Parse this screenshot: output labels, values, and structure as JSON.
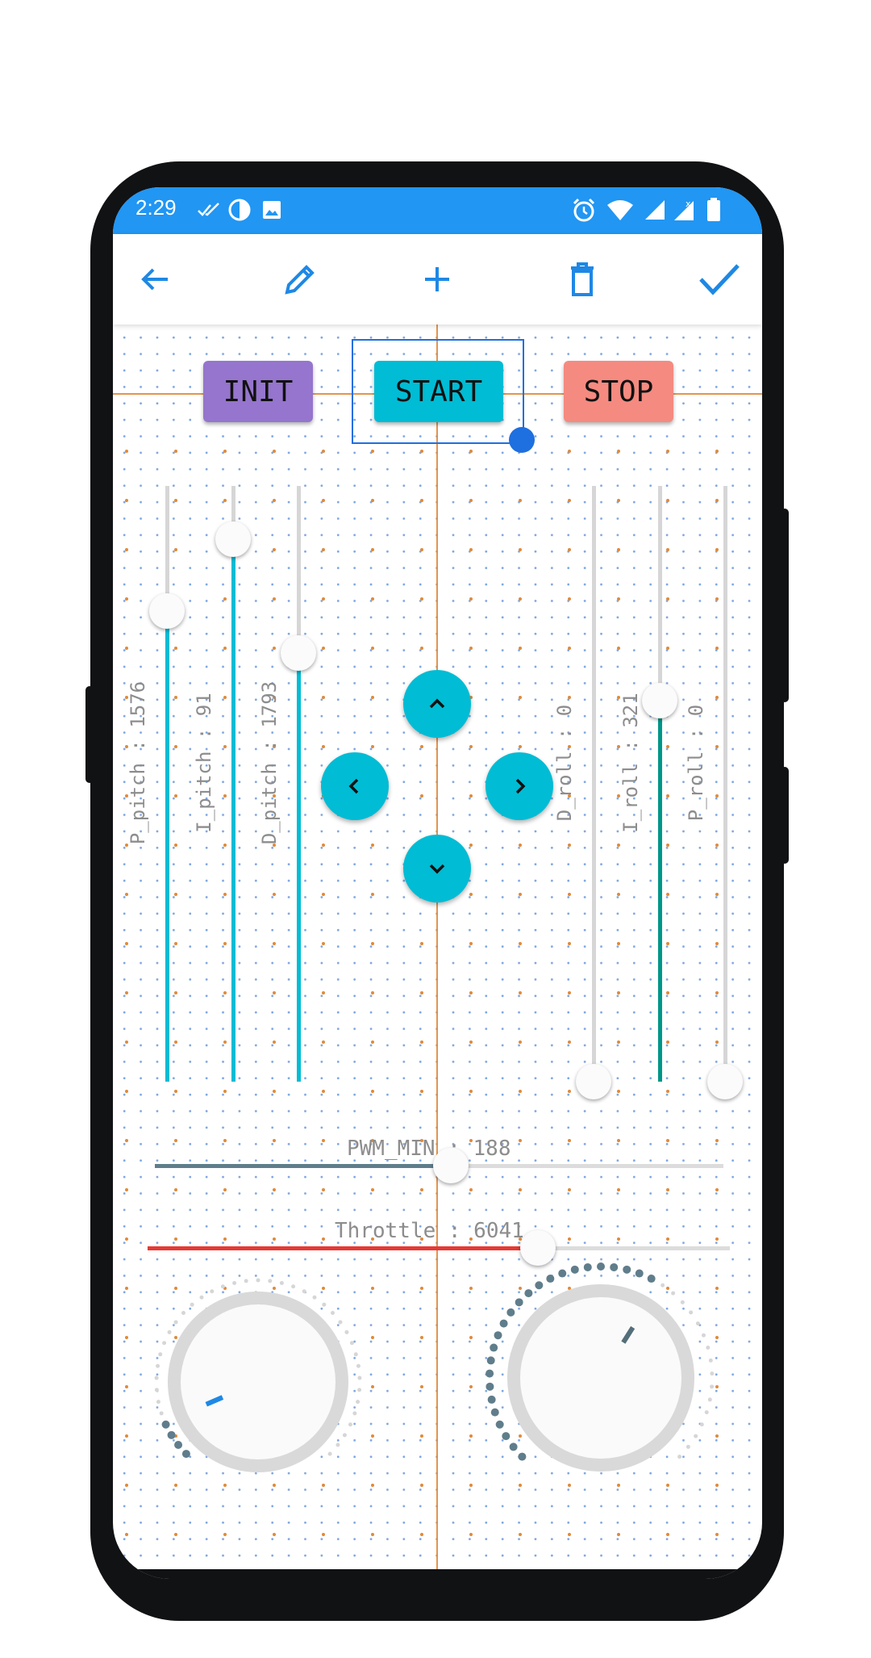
{
  "status_bar": {
    "time": "2:29",
    "left_icons": [
      "double-check-icon",
      "half-moon-icon",
      "image-icon"
    ],
    "right_icons": [
      "alarm-icon",
      "wifi-icon",
      "signal-icon",
      "signal-no-data-icon",
      "battery-icon"
    ],
    "color": "#2196f3"
  },
  "toolbar": {
    "icons": [
      "back-arrow-icon",
      "pencil-icon",
      "plus-icon",
      "trash-icon",
      "check-icon"
    ],
    "accent": "#1e88e5"
  },
  "buttons": {
    "init": {
      "label": "INIT",
      "color": "#9575cd"
    },
    "start": {
      "label": "START",
      "color": "#00bcd4"
    },
    "stop": {
      "label": "STOP",
      "color": "#f58a80"
    }
  },
  "sliders": {
    "p_pitch": {
      "label": "P_pitch : 1576"
    },
    "i_pitch": {
      "label": "I_pitch : 91"
    },
    "d_pitch": {
      "label": "D_pitch : 1793"
    },
    "d_roll": {
      "label": "D_roll : 0"
    },
    "i_roll": {
      "label": "I_roll : 321"
    },
    "p_roll": {
      "label": "P_roll : 0"
    },
    "pwm_min": {
      "label": "PWM_MIN : 188"
    },
    "throttle": {
      "label": "Throttle : 6041"
    }
  },
  "slider_levels": {
    "p_pitch": 0.79,
    "i_pitch": 0.91,
    "d_pitch": 0.72,
    "d_roll": 0.0,
    "i_roll": 0.64,
    "p_roll": 0.0,
    "pwm_min": 0.52,
    "throttle": 0.67
  },
  "colors": {
    "pitch": "#00bcd4",
    "i_roll": "#009688",
    "pwm_min": "#607d8b",
    "throttle": "#e53935",
    "grid_dot": "#7fa7de",
    "guide": "#e08a3a"
  },
  "dpad": {
    "icons": [
      "chevron-up-icon",
      "chevron-left-icon",
      "chevron-right-icon",
      "chevron-down-icon"
    ]
  },
  "knobs": {
    "left": {
      "level": 0.08
    },
    "right": {
      "level": 0.62
    }
  }
}
